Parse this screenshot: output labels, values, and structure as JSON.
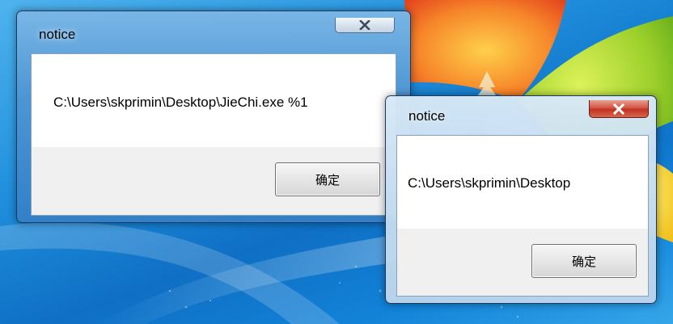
{
  "dialogs": [
    {
      "title": "notice",
      "message": "C:\\Users\\skprimin\\Desktop\\JieChi.exe %1",
      "ok_label": "确定",
      "active": false
    },
    {
      "title": "notice",
      "message": "C:\\Users\\skprimin\\Desktop",
      "ok_label": "确定",
      "active": true
    }
  ],
  "icons": {
    "close": "close-icon"
  },
  "colors": {
    "desktop_blue": "#1f8fdc",
    "close_active_red": "#c2321f",
    "active_frame": "#c4dcf0",
    "inactive_frame": "#4e96d4"
  }
}
